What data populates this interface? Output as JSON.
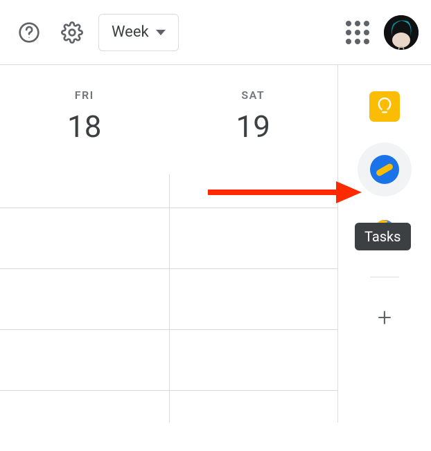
{
  "toolbar": {
    "view_label": "Week"
  },
  "calendar": {
    "days": [
      {
        "name": "FRI",
        "num": "18"
      },
      {
        "name": "SAT",
        "num": "19"
      }
    ]
  },
  "sidepanel": {
    "tasks_tooltip": "Tasks",
    "add_symbol": "+"
  },
  "colors": {
    "keep": "#fbbc04",
    "tasks_bg": "#1a73e8",
    "tooltip_bg": "#3c4043",
    "arrow": "#ff2a00"
  }
}
